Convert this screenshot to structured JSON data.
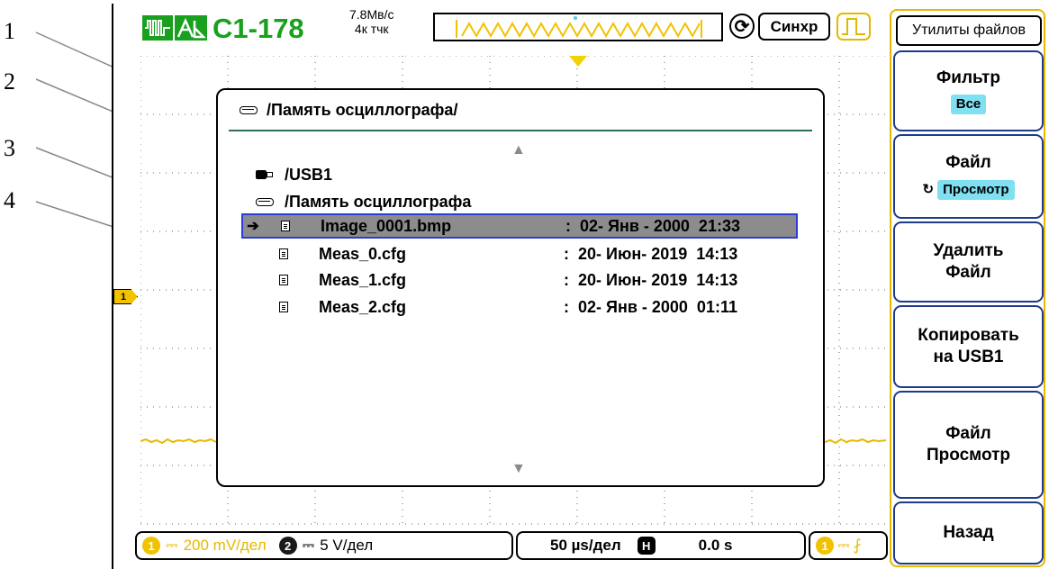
{
  "callouts": [
    "1",
    "2",
    "3",
    "4"
  ],
  "header": {
    "model": "С1-178",
    "sample_rate": "7.8Мв/с",
    "points": "4к тчк",
    "sync_label": "Синхр"
  },
  "dialog": {
    "path": "/Память осциллографа/",
    "directories": [
      {
        "name": "/USB1",
        "icon": "usb-icon"
      },
      {
        "name": "/Память осциллографа",
        "icon": "drive-icon"
      }
    ],
    "files": [
      {
        "name": "Image_0001.bmp",
        "date": ":  02- Янв - 2000  21:33",
        "selected": true
      },
      {
        "name": "Meas_0.cfg",
        "date": ":  20- Июн- 2019  14:13",
        "selected": false
      },
      {
        "name": "Meas_1.cfg",
        "date": ":  20- Июн- 2019  14:13",
        "selected": false
      },
      {
        "name": "Meas_2.cfg",
        "date": ":  02- Янв - 2000  01:11",
        "selected": false
      }
    ]
  },
  "channel_marker": "1",
  "status_bar": {
    "ch1_num": "1",
    "ch1_scale": "200 mV/дел",
    "ch2_num": "2",
    "ch2_scale": "5 V/дел",
    "timebase": "50 µs/дел",
    "h_label": "H",
    "delay": "0.0 s",
    "trig_num": "1"
  },
  "menu": {
    "title": "Утилиты файлов",
    "filter_label": "Фильтр",
    "filter_value": "Все",
    "file_label": "Файл",
    "file_value": "Просмотр",
    "delete_line1": "Удалить",
    "delete_line2": "Файл",
    "copy_line1": "Копировать",
    "copy_line2": "на USB1",
    "view_line1": "Файл",
    "view_line2": "Просмотр",
    "back_label": "Назад"
  },
  "colors": {
    "brand_green": "#19a01f",
    "ch1_yellow": "#f2c200",
    "selection_gray": "#8c8c8c",
    "selection_border": "#2a3fd2",
    "chip_cyan": "#7ee0f0"
  }
}
